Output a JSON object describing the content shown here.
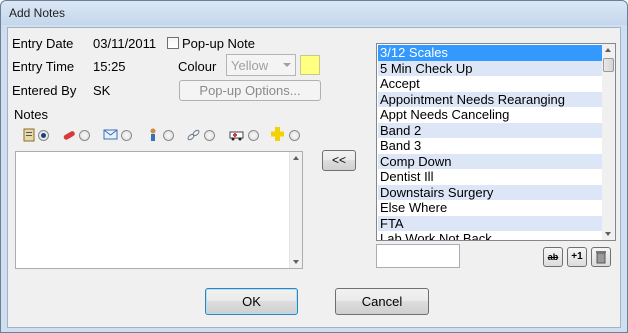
{
  "window": {
    "title": "Add Notes"
  },
  "entry": {
    "date_label": "Entry Date",
    "date_value": "03/11/2011",
    "time_label": "Entry Time",
    "time_value": "15:25",
    "by_label": "Entered By",
    "by_value": "SK"
  },
  "popup": {
    "checkbox_label": "Pop-up Note",
    "checked": false,
    "colour_label": "Colour",
    "colour_value": "Yellow",
    "swatch_color": "#ffff80",
    "options_button": "Pop-up Options..."
  },
  "notes": {
    "label": "Notes",
    "type_icons": [
      "notes-icon",
      "pills-icon",
      "envelope-icon",
      "person-icon",
      "link-icon",
      "ambulance-icon",
      "medical-cross-icon"
    ],
    "selected_type_index": 0,
    "text": ""
  },
  "transfer_button": "<<",
  "phrase_list": {
    "items": [
      "3/12 Scales",
      "5 Min Check Up",
      "Accept",
      "Appointment Needs Rearanging",
      "Appt Needs Canceling",
      "Band 2",
      "Band 3",
      "Comp Down",
      "Dentist Ill",
      "Downstairs Surgery",
      "Else Where",
      "FTA",
      "Lab Work Not Back"
    ],
    "selected_index": 0,
    "new_value": ""
  },
  "list_tools": {
    "edit_label": "ab",
    "add_label": "+1",
    "delete_icon": "trash-icon"
  },
  "buttons": {
    "ok": "OK",
    "cancel": "Cancel"
  }
}
